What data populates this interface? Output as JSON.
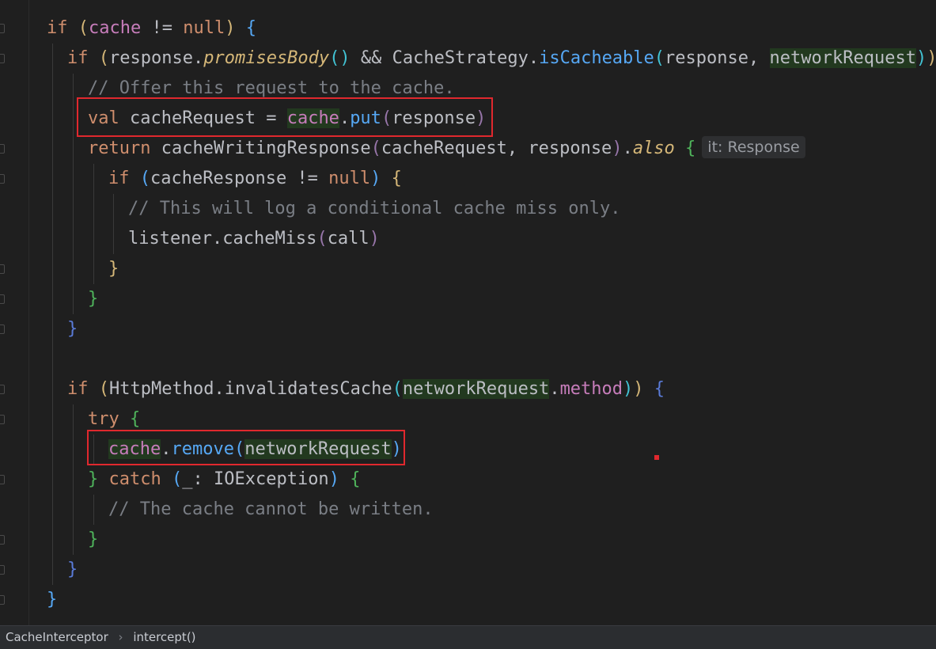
{
  "code": {
    "lines": [
      {
        "id": "l1"
      },
      {
        "id": "l2"
      }
    ],
    "tokens": {
      "if": "if",
      "cache": "cache",
      "neq": " != ",
      "null": "null",
      "response": "response",
      "promisesBody": "promisesBody",
      "and": " && ",
      "CacheStrategy": "CacheStrategy",
      "isCacheable": "isCacheable",
      "networkRequest": "networkRequest",
      "comment_offer": "// Offer this request to the cache.",
      "val": "val",
      "cacheRequest": "cacheRequest",
      "eq": " = ",
      "put": "put",
      "return": "return",
      "cacheWritingResponse": "cacheWritingResponse",
      "also": "also",
      "hint_it": "it: Response",
      "cacheResponse": "cacheResponse",
      "comment_log": "// This will log a conditional cache miss only.",
      "listener": "listener",
      "cacheMiss": "cacheMiss",
      "call": "call",
      "HttpMethod": "HttpMethod",
      "invalidatesCache": "invalidatesCache",
      "method": "method",
      "try": "try",
      "remove": "remove",
      "catch": "catch",
      "underscore": "_",
      "IOException": "IOException",
      "comment_written": "// The cache cannot be written."
    }
  },
  "breadcrumb": {
    "items": [
      "CacheInterceptor",
      "intercept()"
    ],
    "separator": "›"
  },
  "colors": {
    "background": "#1f1f1f",
    "keyword": "#cf8e6d",
    "function": "#56a8f5",
    "comment": "#7a7e85",
    "field": "#c77dbb",
    "highlight_box": "#e0282e"
  }
}
